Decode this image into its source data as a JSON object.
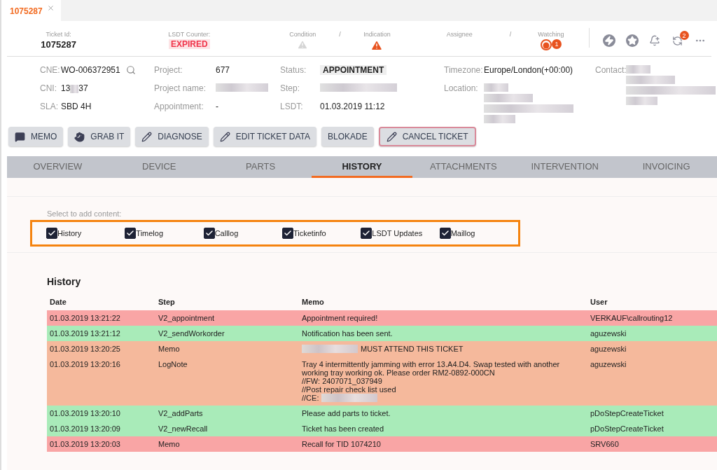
{
  "document_tab": {
    "label": "1075287",
    "selected": true
  },
  "summary": {
    "ticket_id": {
      "label": "Ticket Id:",
      "value": "1075287"
    },
    "lsdt_counter": {
      "label": "LSDT Counter:",
      "value": "EXPIRED"
    },
    "condition": {
      "label": "Condition"
    },
    "separator_1": "/",
    "indication": {
      "label": "Indication"
    },
    "assignee": {
      "label": "Assignee"
    },
    "separator_2": "/",
    "watching": {
      "label": "Watching",
      "count": "1"
    },
    "notification_count": "2"
  },
  "details": [
    [
      {
        "label": "CNE:",
        "value": "WO-006372951",
        "kind": "search"
      },
      {
        "label": "CNI:",
        "value": "13",
        "value_end": "37",
        "kind": "partly-redacted"
      },
      {
        "label": "SLA:",
        "value": "SBD 4H",
        "kind": "text"
      }
    ],
    [
      {
        "label": "Project:",
        "value": "677",
        "kind": "text"
      },
      {
        "label": "Project name:",
        "kind": "redacted"
      },
      {
        "label": "Appointment:",
        "value": "-",
        "kind": "text"
      }
    ],
    [
      {
        "label": "Status:",
        "value": "APPOINTMENT",
        "kind": "status"
      },
      {
        "label": "Step:",
        "kind": "redacted"
      },
      {
        "label": "LSDT:",
        "value": "01.03.2019 11:12",
        "kind": "text"
      }
    ],
    [
      {
        "label": "Timezone:",
        "value": "Europe/London(+00:00)",
        "kind": "text"
      },
      {
        "label": "Location:",
        "kind": "redacted-block"
      }
    ],
    [
      {
        "label": "Contact:",
        "kind": "redacted-block"
      }
    ]
  ],
  "actions": [
    {
      "label": "MEMO",
      "kind": "normal"
    },
    {
      "label": "GRAB IT",
      "kind": "normal"
    },
    {
      "label": "DIAGNOSE",
      "kind": "normal"
    },
    {
      "label": "EDIT TICKET DATA",
      "kind": "normal"
    },
    {
      "label": "BLOKADE",
      "kind": "normal"
    },
    {
      "label": "CANCEL TICKET",
      "kind": "danger"
    }
  ],
  "tabs": [
    {
      "label": "OVERVIEW",
      "selected": false
    },
    {
      "label": "DEVICE",
      "selected": false
    },
    {
      "label": "PARTS",
      "selected": false
    },
    {
      "label": "HISTORY",
      "selected": true
    },
    {
      "label": "ATTACHMENTS",
      "selected": false
    },
    {
      "label": "INTERVENTION",
      "selected": false
    },
    {
      "label": "INVOICING",
      "selected": false
    }
  ],
  "content_selector": {
    "hint": "Select to add content:",
    "options": [
      {
        "label": "History",
        "checked": true
      },
      {
        "label": "Timelog",
        "checked": true
      },
      {
        "label": "Calllog",
        "checked": true
      },
      {
        "label": "Ticketinfo",
        "checked": true
      },
      {
        "label": "LSDT Updates",
        "checked": true
      },
      {
        "label": "Maillog",
        "checked": true
      }
    ]
  },
  "history": {
    "title": "History",
    "columns": [
      "Date",
      "Step",
      "Memo",
      "User"
    ],
    "rows": [
      {
        "date": "01.03.2019 13:21:22",
        "step": "V2_appointment",
        "memo": [
          {
            "text": "Appointment required!"
          }
        ],
        "user": "VERKAUF\\callrouting12",
        "color": "#f9a5a5"
      },
      {
        "date": "01.03.2019 13:21:12",
        "step": "V2_sendWorkorder",
        "memo": [
          {
            "text": "Notification has been sent."
          }
        ],
        "user": "aguzewski",
        "color": "#a9ebb9"
      },
      {
        "date": "01.03.2019 13:20:25",
        "step": "Memo",
        "memo": [
          {
            "text": "MUST ATTEND THIS TICKET",
            "kind": "redacted-prefix"
          }
        ],
        "user": "aguzewski",
        "color": "#f5b99c"
      },
      {
        "date": "01.03.2019 13:20:16",
        "step": "LogNote",
        "memo": [
          {
            "text": "Tray 4 intermittently jamming with error 13.A4.D4. Swap tested with another"
          },
          {
            "text": "working tray working ok. Please order RM2-0892-000CN"
          },
          {
            "text": "//FW: 2407071_037949"
          },
          {
            "text": "//Post repair check list used"
          },
          {
            "text": "//CE:",
            "kind": "redacted-suffix"
          }
        ],
        "user": "aguzewski",
        "color": "#f5b99c"
      },
      {
        "date": "01.03.2019 13:20:10",
        "step": "V2_addParts",
        "memo": [
          {
            "text": "Please add parts to ticket."
          }
        ],
        "user": "pDoStepCreateTicket",
        "color": "#a9ebb9"
      },
      {
        "date": "01.03.2019 13:20:09",
        "step": "V2_newRecall",
        "memo": [
          {
            "text": "Ticket has been created"
          }
        ],
        "user": "pDoStepCreateTicket",
        "color": "#a9ebb9"
      },
      {
        "date": "01.03.2019 13:20:03",
        "step": "Memo",
        "memo": [
          {
            "text": "Recall for TID 1074210"
          }
        ],
        "user": "SRV660",
        "color": "#f9a5a5"
      }
    ]
  }
}
